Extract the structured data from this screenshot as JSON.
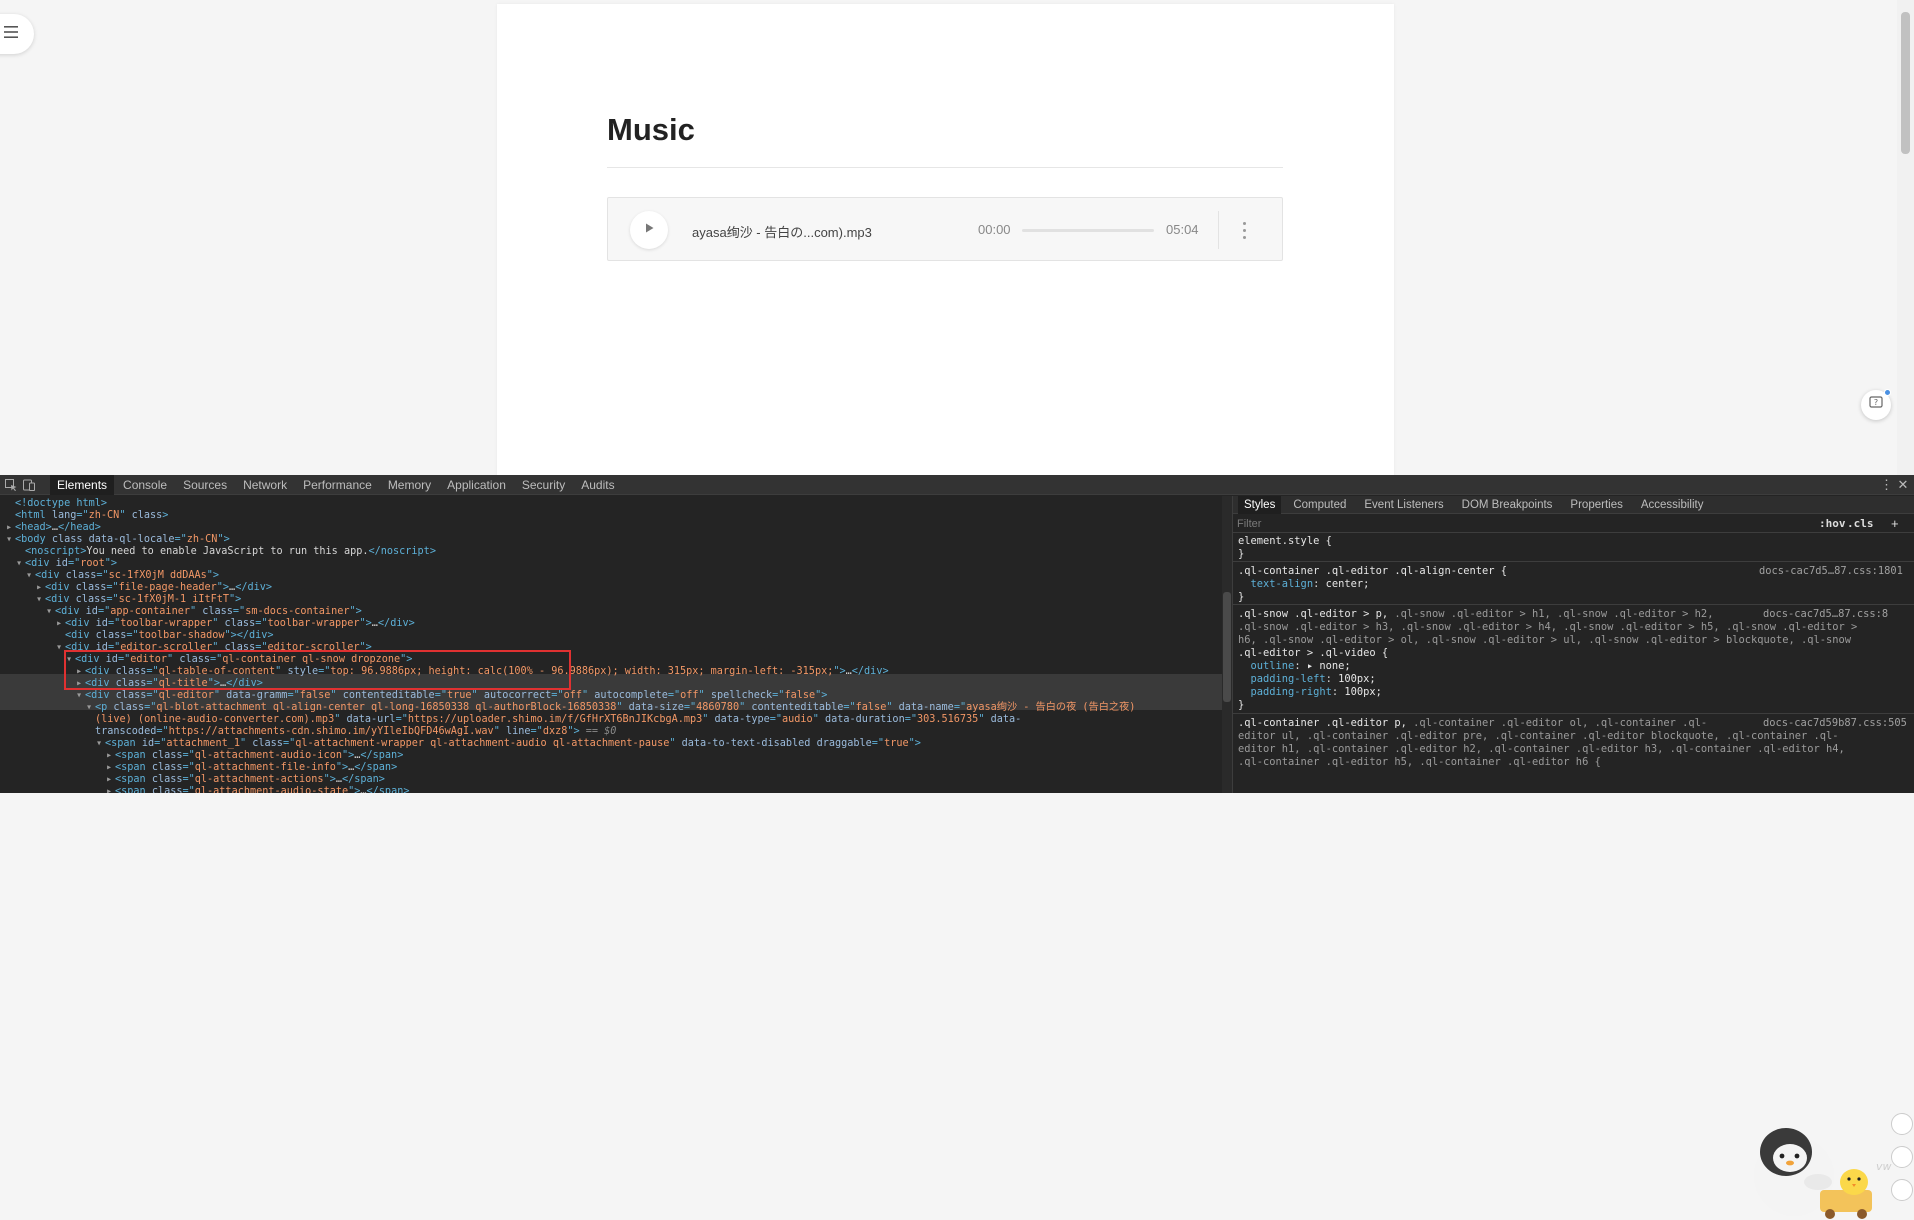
{
  "page": {
    "doc_title": "Music",
    "audio": {
      "file_name": "ayasa绚沙 - 告白の...com).mp3",
      "current_time": "00:00",
      "total_time": "05:04"
    }
  },
  "devtools": {
    "tabs": [
      "Elements",
      "Console",
      "Sources",
      "Network",
      "Performance",
      "Memory",
      "Application",
      "Security",
      "Audits"
    ],
    "active_tab": "Elements",
    "menu_glyph": "⋮",
    "close_glyph": "✕",
    "dom_lines": [
      {
        "indent": 0,
        "tri": "",
        "parts": [
          [
            "tg",
            "<!doctype html>"
          ]
        ]
      },
      {
        "indent": 0,
        "tri": "",
        "parts": [
          [
            "tg",
            "<html "
          ],
          [
            "an",
            "lang"
          ],
          [
            "tg",
            "=\""
          ],
          [
            "av",
            "zh-CN"
          ],
          [
            "tg",
            "\" "
          ],
          [
            "an",
            "class"
          ],
          [
            "tg",
            ">"
          ]
        ]
      },
      {
        "indent": 0,
        "tri": "▸",
        "parts": [
          [
            "tg",
            "<head>"
          ],
          [
            "tx",
            "…"
          ],
          [
            "tg",
            "</head>"
          ]
        ]
      },
      {
        "indent": 0,
        "tri": "▾",
        "parts": [
          [
            "tg",
            "<body "
          ],
          [
            "an",
            "class data-ql-locale"
          ],
          [
            "tg",
            "=\""
          ],
          [
            "av",
            "zh-CN"
          ],
          [
            "tg",
            "\">"
          ]
        ]
      },
      {
        "indent": 1,
        "tri": "",
        "parts": [
          [
            "tg",
            "<noscript>"
          ],
          [
            "tx",
            "You need to enable JavaScript to run this app."
          ],
          [
            "tg",
            "</noscript>"
          ]
        ]
      },
      {
        "indent": 1,
        "tri": "▾",
        "parts": [
          [
            "tg",
            "<div "
          ],
          [
            "an",
            "id"
          ],
          [
            "tg",
            "=\""
          ],
          [
            "av",
            "root"
          ],
          [
            "tg",
            "\">"
          ]
        ]
      },
      {
        "indent": 2,
        "tri": "▾",
        "parts": [
          [
            "tg",
            "<div "
          ],
          [
            "an",
            "class"
          ],
          [
            "tg",
            "=\""
          ],
          [
            "av",
            "sc-1fX0jM ddDAAs"
          ],
          [
            "tg",
            "\">"
          ]
        ]
      },
      {
        "indent": 3,
        "tri": "▸",
        "parts": [
          [
            "tg",
            "<div "
          ],
          [
            "an",
            "class"
          ],
          [
            "tg",
            "=\""
          ],
          [
            "av",
            "file-page-header"
          ],
          [
            "tg",
            "\">"
          ],
          [
            "tx",
            "…"
          ],
          [
            "tg",
            "</div>"
          ]
        ]
      },
      {
        "indent": 3,
        "tri": "▾",
        "parts": [
          [
            "tg",
            "<div "
          ],
          [
            "an",
            "class"
          ],
          [
            "tg",
            "=\""
          ],
          [
            "av",
            "sc-1fX0jM-1 iItFtT"
          ],
          [
            "tg",
            "\">"
          ]
        ]
      },
      {
        "indent": 4,
        "tri": "▾",
        "parts": [
          [
            "tg",
            "<div "
          ],
          [
            "an",
            "id"
          ],
          [
            "tg",
            "=\""
          ],
          [
            "av",
            "app-container"
          ],
          [
            "tg",
            "\" "
          ],
          [
            "an",
            "class"
          ],
          [
            "tg",
            "=\""
          ],
          [
            "av",
            "sm-docs-container"
          ],
          [
            "tg",
            "\">"
          ]
        ]
      },
      {
        "indent": 5,
        "tri": "▸",
        "parts": [
          [
            "tg",
            "<div "
          ],
          [
            "an",
            "id"
          ],
          [
            "tg",
            "=\""
          ],
          [
            "av",
            "toolbar-wrapper"
          ],
          [
            "tg",
            "\" "
          ],
          [
            "an",
            "class"
          ],
          [
            "tg",
            "=\""
          ],
          [
            "av",
            "toolbar-wrapper"
          ],
          [
            "tg",
            "\">"
          ],
          [
            "tx",
            "…"
          ],
          [
            "tg",
            "</div>"
          ]
        ]
      },
      {
        "indent": 5,
        "tri": "",
        "parts": [
          [
            "tg",
            "<div "
          ],
          [
            "an",
            "class"
          ],
          [
            "tg",
            "=\""
          ],
          [
            "av",
            "toolbar-shadow"
          ],
          [
            "tg",
            "\"></div>"
          ]
        ]
      },
      {
        "indent": 5,
        "tri": "▾",
        "parts": [
          [
            "tg",
            "<div "
          ],
          [
            "an",
            "id"
          ],
          [
            "tg",
            "=\""
          ],
          [
            "av",
            "editor-scroller"
          ],
          [
            "tg",
            "\" "
          ],
          [
            "an",
            "class"
          ],
          [
            "tg",
            "=\""
          ],
          [
            "av",
            "editor-scroller"
          ],
          [
            "tg",
            "\">"
          ]
        ]
      },
      {
        "indent": 6,
        "tri": "▾",
        "parts": [
          [
            "tg",
            "<div "
          ],
          [
            "an",
            "id"
          ],
          [
            "tg",
            "=\""
          ],
          [
            "av",
            "editor"
          ],
          [
            "tg",
            "\" "
          ],
          [
            "an",
            "class"
          ],
          [
            "tg",
            "=\""
          ],
          [
            "av",
            "ql-container ql-snow dropzone"
          ],
          [
            "tg",
            "\">"
          ]
        ]
      },
      {
        "indent": 7,
        "tri": "▸",
        "parts": [
          [
            "tg",
            "<div "
          ],
          [
            "an",
            "class"
          ],
          [
            "tg",
            "=\""
          ],
          [
            "av",
            "ql-table-of-content"
          ],
          [
            "tg",
            "\" "
          ],
          [
            "an",
            "style"
          ],
          [
            "tg",
            "=\""
          ],
          [
            "av",
            "top: 96.9886px; height: calc(100% - 96.9886px); width: 315px; margin-left: -315px;"
          ],
          [
            "tg",
            "\">"
          ],
          [
            "tx",
            "…"
          ],
          [
            "tg",
            "</div>"
          ]
        ]
      },
      {
        "indent": 7,
        "tri": "▸",
        "parts": [
          [
            "tg",
            "<div "
          ],
          [
            "an",
            "class"
          ],
          [
            "tg",
            "=\""
          ],
          [
            "av",
            "ql-title"
          ],
          [
            "tg",
            "\">"
          ],
          [
            "tx",
            "…"
          ],
          [
            "tg",
            "</div>"
          ]
        ]
      },
      {
        "indent": 7,
        "tri": "▾",
        "parts": [
          [
            "tg",
            "<div "
          ],
          [
            "an",
            "class"
          ],
          [
            "tg",
            "=\""
          ],
          [
            "av",
            "ql-editor"
          ],
          [
            "tg",
            "\" "
          ],
          [
            "an",
            "data-gramm"
          ],
          [
            "tg",
            "=\""
          ],
          [
            "av",
            "false"
          ],
          [
            "tg",
            "\" "
          ],
          [
            "an",
            "contenteditable"
          ],
          [
            "tg",
            "=\""
          ],
          [
            "av",
            "true"
          ],
          [
            "tg",
            "\" "
          ],
          [
            "an",
            "autocorrect"
          ],
          [
            "tg",
            "=\""
          ],
          [
            "av",
            "off"
          ],
          [
            "tg",
            "\" "
          ],
          [
            "an",
            "autocomplete"
          ],
          [
            "tg",
            "=\""
          ],
          [
            "av",
            "off"
          ],
          [
            "tg",
            "\" "
          ],
          [
            "an",
            "spellcheck"
          ],
          [
            "tg",
            "=\""
          ],
          [
            "av",
            "false"
          ],
          [
            "tg",
            "\">"
          ]
        ]
      },
      {
        "indent": 8,
        "tri": "▾",
        "parts": [
          [
            "tg",
            "<p "
          ],
          [
            "an",
            "class"
          ],
          [
            "tg",
            "=\""
          ],
          [
            "av",
            "ql-blot-attachment ql-align-center ql-long-16850338 ql-authorBlock-16850338"
          ],
          [
            "tg",
            "\" "
          ],
          [
            "an",
            "data-size"
          ],
          [
            "tg",
            "=\""
          ],
          [
            "av",
            "4860780"
          ],
          [
            "tg",
            "\" "
          ],
          [
            "an",
            "contenteditable"
          ],
          [
            "tg",
            "=\""
          ],
          [
            "av",
            "false"
          ],
          [
            "tg",
            "\" "
          ],
          [
            "an",
            "data-name"
          ],
          [
            "tg",
            "=\""
          ],
          [
            "av",
            "ayasa绚沙 - 告白の夜 (告白之夜)"
          ]
        ]
      },
      {
        "indent": 8,
        "tri": "",
        "parts": [
          [
            "av",
            "(live) (online-audio-converter.com).mp3"
          ],
          [
            "tg",
            "\" "
          ],
          [
            "an",
            "data-url"
          ],
          [
            "tg",
            "=\""
          ],
          [
            "av",
            "https://uploader.shimo.im/f/GfHrXT6BnJIKcbgA.mp3"
          ],
          [
            "tg",
            "\" "
          ],
          [
            "an",
            "data-type"
          ],
          [
            "tg",
            "=\""
          ],
          [
            "av",
            "audio"
          ],
          [
            "tg",
            "\" "
          ],
          [
            "an",
            "data-duration"
          ],
          [
            "tg",
            "=\""
          ],
          [
            "av",
            "303.516735"
          ],
          [
            "tg",
            "\" "
          ],
          [
            "an",
            "data-"
          ]
        ]
      },
      {
        "indent": 8,
        "tri": "",
        "parts": [
          [
            "an",
            "transcoded"
          ],
          [
            "tg",
            "=\""
          ],
          [
            "av",
            "https://attachments-cdn.shimo.im/yYIleIbQFD46wAgI.wav"
          ],
          [
            "tg",
            "\" "
          ],
          [
            "an",
            "line"
          ],
          [
            "tg",
            "=\""
          ],
          [
            "av",
            "dxz8"
          ],
          [
            "tg",
            "\">"
          ],
          [
            "cm",
            " == $0"
          ]
        ]
      },
      {
        "indent": 9,
        "tri": "▾",
        "parts": [
          [
            "tg",
            "<span "
          ],
          [
            "an",
            "id"
          ],
          [
            "tg",
            "=\""
          ],
          [
            "av",
            "attachment_1"
          ],
          [
            "tg",
            "\" "
          ],
          [
            "an",
            "class"
          ],
          [
            "tg",
            "=\""
          ],
          [
            "av",
            "ql-attachment-wrapper ql-attachment-audio ql-attachment-pause"
          ],
          [
            "tg",
            "\" "
          ],
          [
            "an",
            "data-to-text-disabled draggable"
          ],
          [
            "tg",
            "=\""
          ],
          [
            "av",
            "true"
          ],
          [
            "tg",
            "\">"
          ]
        ]
      },
      {
        "indent": 10,
        "tri": "▸",
        "parts": [
          [
            "tg",
            "<span "
          ],
          [
            "an",
            "class"
          ],
          [
            "tg",
            "=\""
          ],
          [
            "av",
            "ql-attachment-audio-icon"
          ],
          [
            "tg",
            "\">"
          ],
          [
            "tx",
            "…"
          ],
          [
            "tg",
            "</span>"
          ]
        ]
      },
      {
        "indent": 10,
        "tri": "▸",
        "parts": [
          [
            "tg",
            "<span "
          ],
          [
            "an",
            "class"
          ],
          [
            "tg",
            "=\""
          ],
          [
            "av",
            "ql-attachment-file-info"
          ],
          [
            "tg",
            "\">"
          ],
          [
            "tx",
            "…"
          ],
          [
            "tg",
            "</span>"
          ]
        ]
      },
      {
        "indent": 10,
        "tri": "▸",
        "parts": [
          [
            "tg",
            "<span "
          ],
          [
            "an",
            "class"
          ],
          [
            "tg",
            "=\""
          ],
          [
            "av",
            "ql-attachment-actions"
          ],
          [
            "tg",
            "\">"
          ],
          [
            "tx",
            "…"
          ],
          [
            "tg",
            "</span>"
          ]
        ]
      },
      {
        "indent": 10,
        "tri": "▸",
        "parts": [
          [
            "tg",
            "<span "
          ],
          [
            "an",
            "class"
          ],
          [
            "tg",
            "=\""
          ],
          [
            "av",
            "ql-attachment-audio-state"
          ],
          [
            "tg",
            "\">"
          ],
          [
            "tx",
            "…"
          ],
          [
            "tg",
            "</span>"
          ]
        ]
      }
    ],
    "styles": {
      "tabs": [
        "Styles",
        "Computed",
        "Event Listeners",
        "DOM Breakpoints",
        "Properties",
        "Accessibility"
      ],
      "active_tab": "Styles",
      "filter_placeholder": "Filter",
      "hov_label": ":hov",
      "cls_label": ".cls",
      "add_label": "+",
      "element_style_selector": "element.style {",
      "close_brace": "}",
      "rule1": {
        "selector": ".ql-container .ql-editor .ql-align-center {",
        "source": "docs-cac7d5…87.css:1801",
        "decl": [
          [
            "text-align",
            "center;"
          ]
        ]
      },
      "rule2": {
        "selector_lines": [
          [
            ".ql-snow .ql-editor > p, ",
            ".ql-snow .ql-editor > h1, .ql-snow .ql-editor > h2, "
          ],
          [
            "",
            ".ql-snow .ql-editor > h3, .ql-snow .ql-editor > h4, .ql-snow .ql-editor > h5, .ql-snow .ql-editor >"
          ],
          [
            "",
            "h6, .ql-snow .ql-editor > ol, .ql-snow .ql-editor > ul, .ql-snow .ql-editor > blockquote, .ql-snow"
          ],
          [
            "",
            ".ql-editor > .ql-video {"
          ]
        ],
        "source": "docs-cac7d5…87.css:8",
        "decl": [
          [
            "outline",
            "▸ none;"
          ],
          [
            "padding-left",
            "100px;"
          ],
          [
            "padding-right",
            "100px;"
          ]
        ]
      },
      "rule3": {
        "selector_lines": [
          [
            ".ql-container .ql-editor p, ",
            ".ql-container .ql-editor ol, .ql-container .ql-"
          ],
          [
            "",
            "editor ul, .ql-container .ql-editor pre, .ql-container .ql-editor blockquote, .ql-container .ql-"
          ],
          [
            "",
            "editor h1, .ql-container .ql-editor h2, .ql-container .ql-editor h3, .ql-container .ql-editor h4,"
          ],
          [
            "",
            ".ql-container .ql-editor h5, .ql-container .ql-editor h6 {"
          ]
        ],
        "source": "docs-cac7d59b87.css:505"
      }
    }
  }
}
